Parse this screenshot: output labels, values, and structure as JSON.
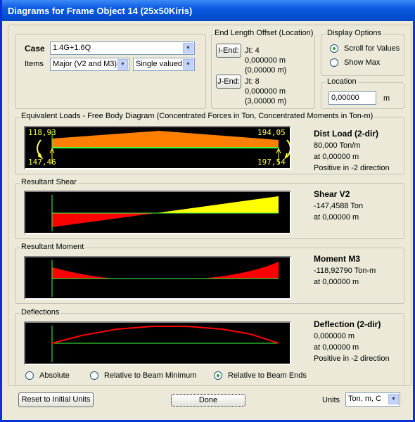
{
  "window": {
    "title": "Diagrams for Frame Object 14  (25x50Kiris)"
  },
  "case": {
    "label": "Case",
    "value": "1.4G+1.6Q",
    "items_label": "Items",
    "items_value": "Major (V2 and M3)",
    "valued": "Single valued"
  },
  "end_offset": {
    "title": "End Length Offset (Location)",
    "i_end_button": "I-End:",
    "i_jt": "Jt:  4",
    "i_offset": "0,000000 m",
    "i_loc": "(0,00000 m)",
    "j_end_button": "J-End:",
    "j_jt": "Jt:  8",
    "j_offset": "0,000000 m",
    "j_loc": "(3,00000 m)"
  },
  "display_options": {
    "title": "Display Options",
    "scroll": "Scroll for Values",
    "show_max": "Show Max",
    "selected": "scroll"
  },
  "location": {
    "title": "Location",
    "value": "0,00000",
    "unit": "m"
  },
  "fbd": {
    "title": "Equivalent Loads - Free Body Diagram  (Concentrated Forces in Ton, Concentrated Moments in Ton-m)",
    "left_moment": "118,93",
    "left_force": "147,46",
    "right_moment": "194,05",
    "right_force": "197,54",
    "info_title": "Dist Load (2-dir)",
    "info_value": "80,000 Ton/m",
    "info_at": "at 0,00000 m",
    "info_dir": "Positive in -2 direction",
    "load_color": "#ff8000"
  },
  "shear": {
    "title": "Resultant Shear",
    "info_title": "Shear V2",
    "info_value": "-147,4588 Ton",
    "info_at": "at 0,00000 m",
    "neg_color": "#ff0000",
    "pos_color": "#ffff00"
  },
  "moment": {
    "title": "Resultant Moment",
    "info_title": "Moment M3",
    "info_value": "-118,92790 Ton-m",
    "info_at": "at 0,00000 m"
  },
  "deflection": {
    "title": "Deflections",
    "info_title": "Deflection (2-dir)",
    "info_value": "0,000000 m",
    "info_at": "at 0,00000 m",
    "info_dir": "Positive in -2 direction",
    "opt_absolute": "Absolute",
    "opt_rel_min": "Relative to Beam Minimum",
    "opt_rel_ends": "Relative to Beam Ends",
    "selected": "rel_ends"
  },
  "footer": {
    "reset": "Reset to Initial Units",
    "done": "Done",
    "units_label": "Units",
    "units_value": "Ton, m, C"
  }
}
